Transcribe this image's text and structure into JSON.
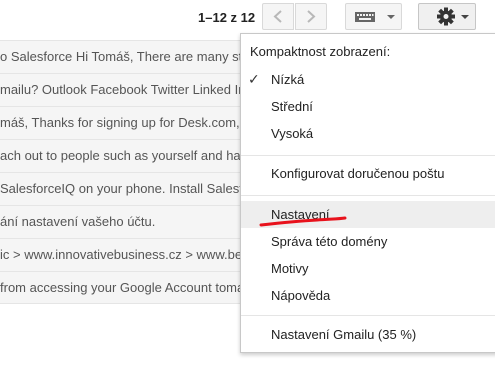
{
  "pager": {
    "range": "1–12 z 12"
  },
  "icons": {
    "prev": "chevron-left-icon",
    "next": "chevron-right-icon",
    "keyboard": "keyboard-icon",
    "settings": "gear-icon",
    "dropdown": "caret-down-icon",
    "check": "checkmark-icon"
  },
  "emails": [
    {
      "snippet": "o Salesforce Hi Tomáš, There are many st"
    },
    {
      "snippet": "mailu? Outlook Facebook Twitter Linked In"
    },
    {
      "snippet": "máš, Thanks for signing up for Desk.com,"
    },
    {
      "snippet": "ach out to people such as yourself and hav"
    },
    {
      "snippet": "SalesforceIQ on your phone. Install Salesf"
    },
    {
      "snippet": "ání nastavení vašeho účtu."
    },
    {
      "snippet": "ic > www.innovativebusiness.cz > www.bes"
    },
    {
      "snippet": "from accessing your Google Account toma"
    }
  ],
  "settings_menu": {
    "density_header": "Kompaktnost zobrazení:",
    "density_options": [
      {
        "label": "Nízká",
        "checked": true
      },
      {
        "label": "Střední",
        "checked": false
      },
      {
        "label": "Vysoká",
        "checked": false
      }
    ],
    "configure_inbox": "Konfigurovat doručenou poštu",
    "items": [
      {
        "label": "Nastavení",
        "highlighted": true
      },
      {
        "label": "Správa této domény",
        "highlighted": false
      },
      {
        "label": "Motivy",
        "highlighted": false
      },
      {
        "label": "Nápověda",
        "highlighted": false
      }
    ],
    "gmail_setup": "Nastavení Gmailu (35 %)",
    "annotation_color": "#e8121c"
  }
}
